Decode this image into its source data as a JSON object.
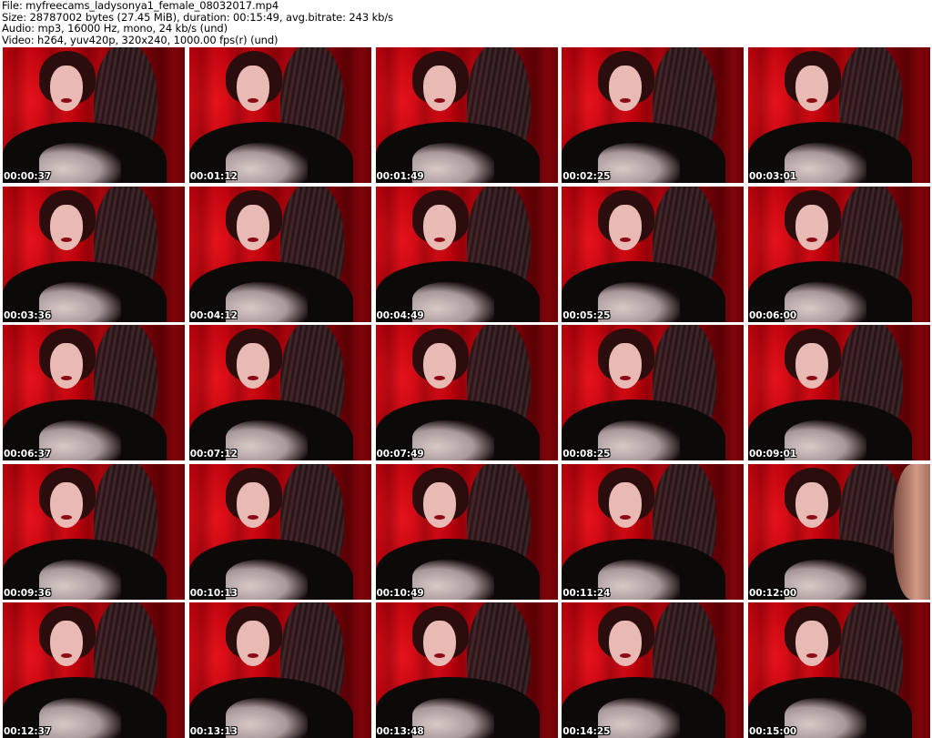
{
  "header": {
    "file_line": "File: myfreecams_ladysonya1_female_08032017.mp4",
    "size_line": "Size: 28787002 bytes (27.45 MiB), duration: 00:15:49, avg.bitrate: 243 kb/s",
    "audio_line": "Audio: mp3, 16000 Hz, mono, 24 kb/s (und)",
    "video_line": "Video: h264, yuv420p, 320x240, 1000.00 fps(r) (und)"
  },
  "thumbnails": [
    {
      "timestamp": "00:00:37"
    },
    {
      "timestamp": "00:01:12"
    },
    {
      "timestamp": "00:01:49"
    },
    {
      "timestamp": "00:02:25"
    },
    {
      "timestamp": "00:03:01"
    },
    {
      "timestamp": "00:03:36"
    },
    {
      "timestamp": "00:04:12"
    },
    {
      "timestamp": "00:04:49"
    },
    {
      "timestamp": "00:05:25"
    },
    {
      "timestamp": "00:06:00"
    },
    {
      "timestamp": "00:06:37"
    },
    {
      "timestamp": "00:07:12"
    },
    {
      "timestamp": "00:07:49"
    },
    {
      "timestamp": "00:08:25"
    },
    {
      "timestamp": "00:09:01"
    },
    {
      "timestamp": "00:09:36"
    },
    {
      "timestamp": "00:10:13"
    },
    {
      "timestamp": "00:10:49"
    },
    {
      "timestamp": "00:11:24"
    },
    {
      "timestamp": "00:12:00"
    },
    {
      "timestamp": "00:12:37"
    },
    {
      "timestamp": "00:13:13"
    },
    {
      "timestamp": "00:13:48"
    },
    {
      "timestamp": "00:14:25"
    },
    {
      "timestamp": "00:15:00"
    }
  ],
  "colors": {
    "background": "#ffffff",
    "text": "#000000",
    "timestamp_text": "#ffffff"
  }
}
